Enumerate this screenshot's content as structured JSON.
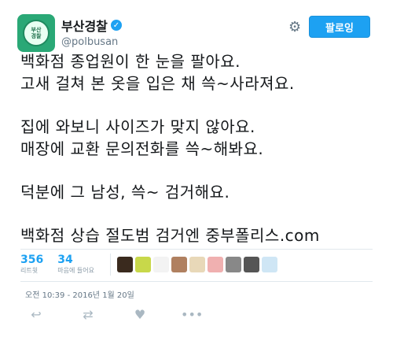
{
  "profile": {
    "avatar_text_top": "부산",
    "avatar_text_bottom": "경찰",
    "display_name": "부산경찰",
    "handle": "@polbusan",
    "verified_icon": "✓"
  },
  "header": {
    "settings_icon": "⚙",
    "follow_label": "팔로잉"
  },
  "tweet": {
    "lines": [
      "백화점 종업원이 한 눈을 팔아요.",
      "고새 걸쳐 본 옷을 입은 채 쓱~사라져요.",
      "",
      "집에 와보니 사이즈가 맞지 않아요.",
      "매장에 교환 문의전화를 쓱~해봐요.",
      "",
      "덕분에 그 남성, 쓱~ 검거해요.",
      "",
      "백화점 상습 절도범 검거엔 중부폴리스.com"
    ]
  },
  "stats": {
    "retweets_count": "356",
    "retweets_label": "리트윗",
    "likes_count": "34",
    "likes_label": "마음에 들어요",
    "likers": [
      {
        "color": "#3a2a1e"
      },
      {
        "color": "#c8d84a"
      },
      {
        "color": "#f3f3f3"
      },
      {
        "color": "#b08060"
      },
      {
        "color": "#e8d8b8"
      },
      {
        "color": "#f0b0b0"
      },
      {
        "color": "#888888"
      },
      {
        "color": "#555555"
      },
      {
        "color": "#cfe6f5"
      }
    ]
  },
  "meta": {
    "timestamp": "오전 10:39 - 2016년 1월 20일"
  },
  "actions": {
    "reply_icon": "↩",
    "retweet_icon": "⇄",
    "like_icon": "♥",
    "more_icon": "•••"
  }
}
